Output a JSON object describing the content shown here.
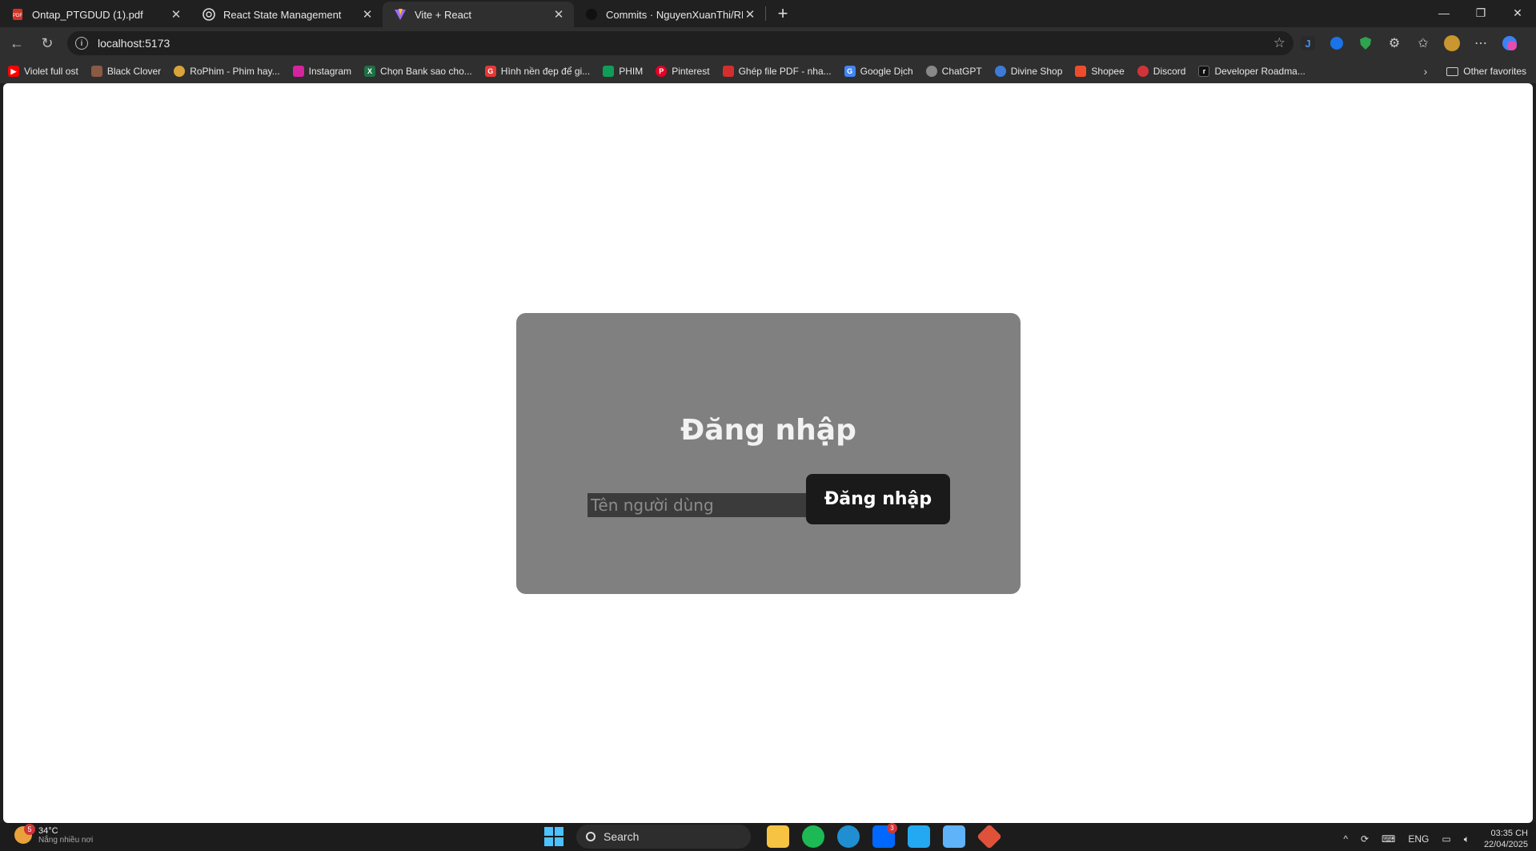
{
  "browser": {
    "tabs": [
      {
        "title": "Ontap_PTGDUD (1).pdf",
        "icon": "pdf-icon",
        "active": false
      },
      {
        "title": "React State Management",
        "icon": "chatgpt-icon",
        "active": false
      },
      {
        "title": "Vite + React",
        "icon": "vite-icon",
        "active": true
      },
      {
        "title": "Commits · NguyenXuanThi/REACT",
        "icon": "github-icon",
        "active": false
      }
    ],
    "tab_close": "✕",
    "new_tab": "+",
    "url": "localhost:5173"
  },
  "bookmarks": [
    {
      "label": "Violet full ost",
      "color": "#ff0000"
    },
    {
      "label": "Black Clover",
      "color": "#8a5a44"
    },
    {
      "label": "RoPhim - Phim hay...",
      "color": "#d9a43a"
    },
    {
      "label": "Instagram",
      "color": "#d6249f"
    },
    {
      "label": "Chọn Bank sao cho...",
      "color": "#1e7145"
    },
    {
      "label": "Hình nền đẹp để gi...",
      "color": "#e53935"
    },
    {
      "label": "PHIM",
      "color": "#0f9d58"
    },
    {
      "label": "Pinterest",
      "color": "#e60023"
    },
    {
      "label": "Ghép file PDF - nha...",
      "color": "#d32f2f"
    },
    {
      "label": "Google Dịch",
      "color": "#4285f4"
    },
    {
      "label": "ChatGPT",
      "color": "#888888"
    },
    {
      "label": "Divine Shop",
      "color": "#3d7bd8"
    },
    {
      "label": "Shopee",
      "color": "#ee4d2d"
    },
    {
      "label": "Discord",
      "color": "#d13438"
    },
    {
      "label": "Developer Roadma...",
      "color": "#111111"
    }
  ],
  "bookmarks_other": "Other favorites",
  "login": {
    "heading": "Đăng nhập",
    "username_placeholder": "Tên người dùng",
    "button": "Đăng nhập"
  },
  "taskbar": {
    "temperature": "34°C",
    "weather_desc": "Nắng nhiều nơi",
    "weather_badge": "5",
    "search": "Search",
    "lang": "ENG",
    "time": "03:35 CH",
    "date": "22/04/2025",
    "zalo_badge": "3"
  }
}
